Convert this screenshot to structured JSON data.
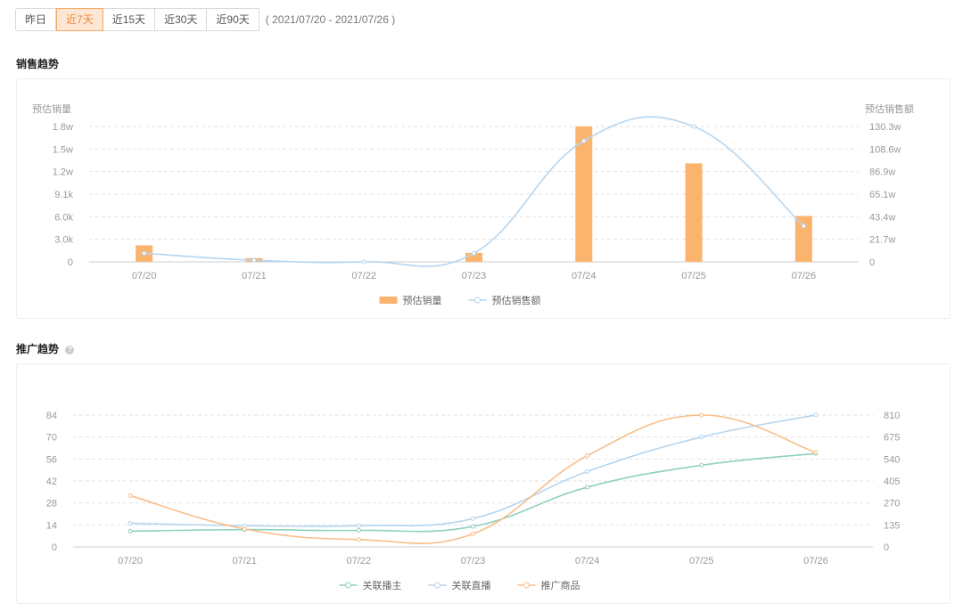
{
  "range_buttons": [
    {
      "label": "昨日",
      "active": false
    },
    {
      "label": "近7天",
      "active": true
    },
    {
      "label": "近15天",
      "active": false
    },
    {
      "label": "近30天",
      "active": false
    },
    {
      "label": "近90天",
      "active": false
    }
  ],
  "date_range": "( 2021/07/20 - 2021/07/26 )",
  "sales_section": {
    "title": "销售趋势"
  },
  "promo_section": {
    "title": "推广趋势",
    "help_icon": "question-circle-icon"
  },
  "chart_data": [
    {
      "type": "bar",
      "categories": [
        "07/20",
        "07/21",
        "07/22",
        "07/23",
        "07/24",
        "07/25",
        "07/26"
      ],
      "ylabel": "预估销量",
      "y2label": "预估销售额",
      "ylim": [
        0,
        18000
      ],
      "y2lim": [
        0,
        130.3
      ],
      "yticks": [
        "0",
        "3.0k",
        "6.0k",
        "9.1k",
        "1.2w",
        "1.5w",
        "1.8w"
      ],
      "y2ticks": [
        "0",
        "21.7w",
        "43.4w",
        "65.1w",
        "86.9w",
        "108.6w",
        "130.3w"
      ],
      "grid": true,
      "legend_position": "bottom",
      "series": [
        {
          "name": "预估销量",
          "type": "bar",
          "axis": "left",
          "color": "#fbb46e",
          "values": [
            2200,
            500,
            0,
            1200,
            18000,
            13100,
            6100
          ]
        },
        {
          "name": "预估销售额",
          "type": "line",
          "axis": "right",
          "color": "#b6d5ee",
          "values": [
            8.3,
            1.5,
            0,
            8.3,
            116.4,
            130.3,
            34.4
          ]
        }
      ]
    },
    {
      "type": "line",
      "categories": [
        "07/20",
        "07/21",
        "07/22",
        "07/23",
        "07/24",
        "07/25",
        "07/26"
      ],
      "ylim": [
        0,
        84
      ],
      "y2lim": [
        0,
        810
      ],
      "yticks": [
        "0",
        "14",
        "28",
        "42",
        "56",
        "70",
        "84"
      ],
      "y2ticks": [
        "0",
        "135",
        "270",
        "405",
        "540",
        "675",
        "810"
      ],
      "grid": true,
      "legend_position": "bottom",
      "series": [
        {
          "name": "关联播主",
          "axis": "left",
          "color": "#8fd0bd",
          "values": [
            10,
            11,
            10.5,
            13,
            38,
            52,
            59.5
          ]
        },
        {
          "name": "关联直播",
          "axis": "left",
          "color": "#b6d5ee",
          "values": [
            15,
            13.5,
            13.5,
            18,
            48,
            70,
            84
          ]
        },
        {
          "name": "推广商品",
          "axis": "right",
          "color": "#f8be88",
          "values": [
            315,
            110,
            45,
            80,
            560,
            810,
            580
          ]
        }
      ]
    }
  ]
}
